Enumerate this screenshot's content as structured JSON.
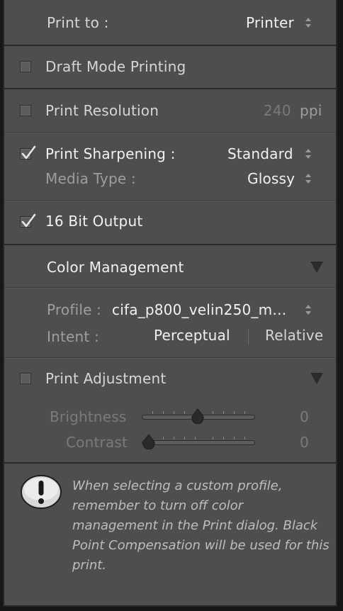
{
  "print_to": {
    "label": "Print to :",
    "value": "Printer"
  },
  "draft_mode": {
    "label": "Draft Mode Printing",
    "checked": false
  },
  "print_resolution": {
    "label": "Print Resolution",
    "value": "240",
    "unit": "ppi",
    "checked": false
  },
  "print_sharpening": {
    "label": "Print Sharpening :",
    "value": "Standard",
    "checked": true
  },
  "media_type": {
    "label": "Media Type :",
    "value": "Glossy"
  },
  "bit_output": {
    "label": "16 Bit Output",
    "checked": true
  },
  "color_management": {
    "title": "Color Management",
    "profile_label": "Profile :",
    "profile_value": "cifa_p800_velin250_m…",
    "intent_label": "Intent :",
    "intent_options": [
      "Perceptual",
      "Relative"
    ],
    "intent_selected": "Perceptual"
  },
  "print_adjustment": {
    "label": "Print Adjustment",
    "checked": false,
    "brightness": {
      "label": "Brightness",
      "value": "0"
    },
    "contrast": {
      "label": "Contrast",
      "value": "0"
    }
  },
  "notice": {
    "text": "When selecting a custom profile, remember to turn off color management in the Print dialog. Black Point Compensation will be used for this print."
  },
  "colors": {
    "panel": "#4e4e4e",
    "background": "#161616",
    "separator": "#2a2a2a"
  }
}
